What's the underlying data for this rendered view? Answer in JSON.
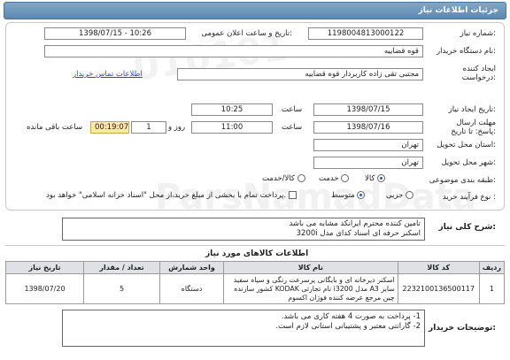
{
  "header": {
    "title": "جزئیات اطلاعات نیاز"
  },
  "watermark": {
    "code": "010101",
    "brand": "ParsNamadData"
  },
  "form": {
    "need_number_label": "شماره نیاز:",
    "need_number": "1198004813000122",
    "announce_label": "تاریخ و ساعت اعلان عمومی:",
    "announce_value": "1398/07/15 - 10:26",
    "buyer_org_label": "نام دستگاه خریدار:",
    "buyer_org": "قوه قضاییه",
    "requester_label": "ایجاد کننده درخواست:",
    "requester": "مجتبی تقی زاده کاربردار قوه قضاییه",
    "contact_link": "اطلاعات تماس خریدار",
    "create_date_label": "تاریخ ایجاد نیاز:",
    "create_date": "1398/07/15",
    "time_label": "ساعت",
    "create_time": "10:25",
    "deadline_label": "مهلت ارسال پاسخ: تا تاریخ:",
    "deadline_date": "1398/07/16",
    "deadline_time": "11:00",
    "days_label": "روز و",
    "days_value": "1",
    "remaining_time": "00:19:07",
    "remaining_label": "ساعت باقی مانده",
    "province_label": "استان محل تحویل:",
    "province": "تهران",
    "city_label": "شهر محل تحویل:",
    "city": "تهران",
    "category_label": "طبقه بندی موضوعی:",
    "category_options": [
      "کالا",
      "خدمت",
      "کالا/خدمت"
    ],
    "purchase_type_label": "نوع فرآیند خرید :",
    "purchase_options": [
      "جزیی",
      "متوسط"
    ],
    "payment_note": "پرداخت تمام یا بخشی از مبلغ خرید،از محل \"اسناد خزانه اسلامی\" خواهد بود."
  },
  "summary": {
    "label": "شرح کلی نیاز:",
    "line1": "تامین کننده محترم ایرانکد مشابه می باشد",
    "line2": "اسکنر حرفه ای اسناد کدای مدل 3200i"
  },
  "items_section": {
    "title": "اطلاعات کالاهای مورد نیاز",
    "headers": [
      "ردیف",
      "کد کالا",
      "نام کالا",
      "واحد شمارش",
      "تعداد / مقدار",
      "تاریخ نیاز"
    ],
    "rows": [
      {
        "row": "1",
        "code": "2232100136500117",
        "name": "اسکنر دیرخانه ای و بایگانی پرسرعت رنگی و سیاه سفید سایز A3 مدل i3200 نام تجارتی KODAK کشور سازنده چین مرجع عرضه کننده فوژان اکسوم",
        "unit": "دستگاه",
        "qty": "5",
        "date": "1398/07/20"
      }
    ]
  },
  "buyer_notes": {
    "label": "توضیحات خریدار:",
    "line1": "1- پرداخت به صورت 4 هفته کاری می باشد.",
    "line2": "2- گارانتی معتبر و پشتیبانی استانی لازم است."
  }
}
